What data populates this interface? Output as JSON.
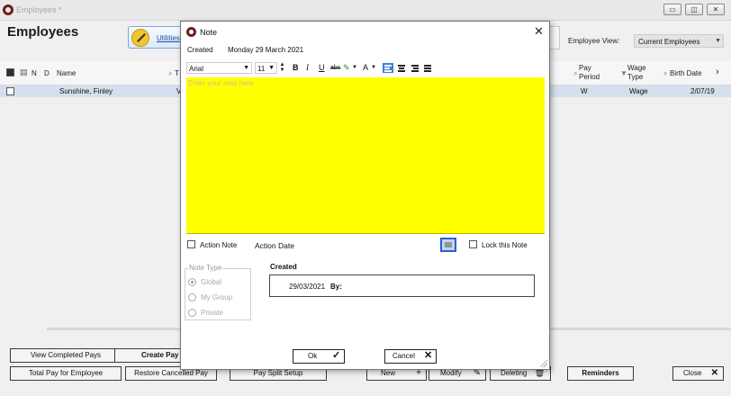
{
  "window": {
    "title": "Employees *",
    "heading": "Employees",
    "min_glyph": "▭",
    "max_glyph": "◫",
    "close_glyph": "✕"
  },
  "toolbar": {
    "utilities_label": "Utilities"
  },
  "view": {
    "label": "Employee View:",
    "value": "Current Employees"
  },
  "grid": {
    "headers": {
      "n": "N",
      "d": "D",
      "name": "Name",
      "t": "T",
      "pay_period": "Pay Period",
      "wage_type": "Wage Type",
      "birth_date": "Birth Date",
      "more": "›"
    },
    "row": {
      "name": "Sunshine, Finley",
      "col_t": "V",
      "pay_period": "W",
      "wage_type": "Wage",
      "birth_date": "2/07/19"
    }
  },
  "buttons": {
    "view_completed": "View Completed Pays",
    "create_pay": "Create Pay",
    "total_pay": "Total Pay for Employee",
    "restore_cancelled": "Restore Cancelled Pay",
    "pay_split": "Pay Split Setup",
    "new": "New",
    "modify": "Modify",
    "deleting": "Deleting",
    "reminders": "Reminders",
    "close": "Close"
  },
  "note": {
    "title": "Note",
    "created_label": "Created",
    "created_value": "Monday 29 March 2021",
    "font": "Arial",
    "size": "11",
    "placeholder": "Enter your note here",
    "action_note": "Action Note",
    "action_date": "Action Date",
    "lock": "Lock this Note",
    "note_type_legend": "Note Type",
    "note_types": [
      "Global",
      "My Group",
      "Private"
    ],
    "created_section": "Created",
    "created_date": "29/03/2021",
    "by_label": "By:",
    "ok": "Ok",
    "cancel": "Cancel"
  },
  "colors": {
    "note_bg": "#ffff00",
    "selected_row": "#d4dfee",
    "accent": "#3f7fd8"
  }
}
